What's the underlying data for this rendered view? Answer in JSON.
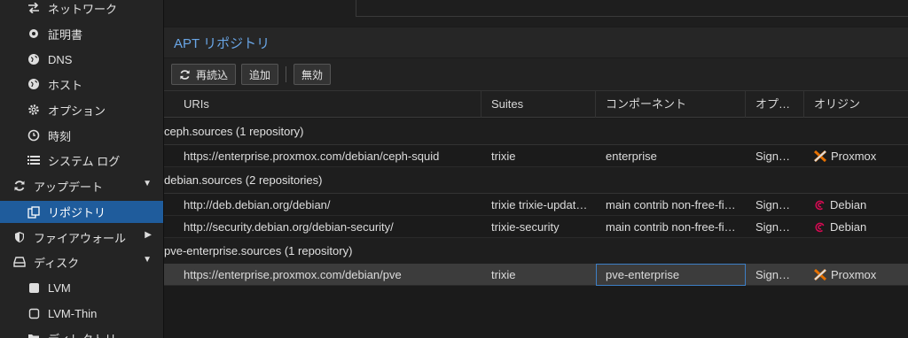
{
  "sidebar": {
    "items": [
      {
        "label": "ネットワーク",
        "icon": "exchange-icon"
      },
      {
        "label": "証明書",
        "icon": "certificate-icon"
      },
      {
        "label": "DNS",
        "icon": "globe-icon"
      },
      {
        "label": "ホスト",
        "icon": "globe-icon"
      },
      {
        "label": "オプション",
        "icon": "gear-icon"
      },
      {
        "label": "時刻",
        "icon": "clock-icon"
      },
      {
        "label": "システム ログ",
        "icon": "list-icon"
      },
      {
        "label": "アップデート",
        "icon": "refresh-icon"
      },
      {
        "label": "リポジトリ",
        "icon": "copy-icon"
      },
      {
        "label": "ファイアウォール",
        "icon": "shield-icon"
      },
      {
        "label": "ディスク",
        "icon": "hdd-icon"
      },
      {
        "label": "LVM",
        "icon": "square-icon"
      },
      {
        "label": "LVM-Thin",
        "icon": "square-outline-icon"
      },
      {
        "label": "ディレクトリ",
        "icon": "folder-icon"
      }
    ]
  },
  "panel": {
    "title": "APT リポジトリ"
  },
  "toolbar": {
    "reload_label": "再読込",
    "add_label": "追加",
    "disable_label": "無効"
  },
  "grid": {
    "columns": [
      "URIs",
      "Suites",
      "コンポーネント",
      "オプ…",
      "オリジン"
    ],
    "groups": [
      {
        "title": "ceph.sources (1 repository)",
        "rows": [
          {
            "uri": "https://enterprise.proxmox.com/debian/ceph-squid",
            "suites": "trixie",
            "components": "enterprise",
            "options": "Sign…",
            "origin": "Proxmox"
          }
        ]
      },
      {
        "title": "debian.sources (2 repositories)",
        "rows": [
          {
            "uri": "http://deb.debian.org/debian/",
            "suites": "trixie trixie-updat…",
            "components": "main contrib non-free-fi…",
            "options": "Sign…",
            "origin": "Debian"
          },
          {
            "uri": "http://security.debian.org/debian-security/",
            "suites": "trixie-security",
            "components": "main contrib non-free-fi…",
            "options": "Sign…",
            "origin": "Debian"
          }
        ]
      },
      {
        "title": "pve-enterprise.sources (1 repository)",
        "rows": [
          {
            "uri": "https://enterprise.proxmox.com/debian/pve",
            "suites": "trixie",
            "components": "pve-enterprise",
            "options": "Sign…",
            "origin": "Proxmox"
          }
        ]
      }
    ]
  },
  "colors": {
    "accent": "#1f5c9c",
    "header_text": "#6aa6e6",
    "proxmox_orange": "#e57000",
    "debian_red": "#d70a53"
  }
}
